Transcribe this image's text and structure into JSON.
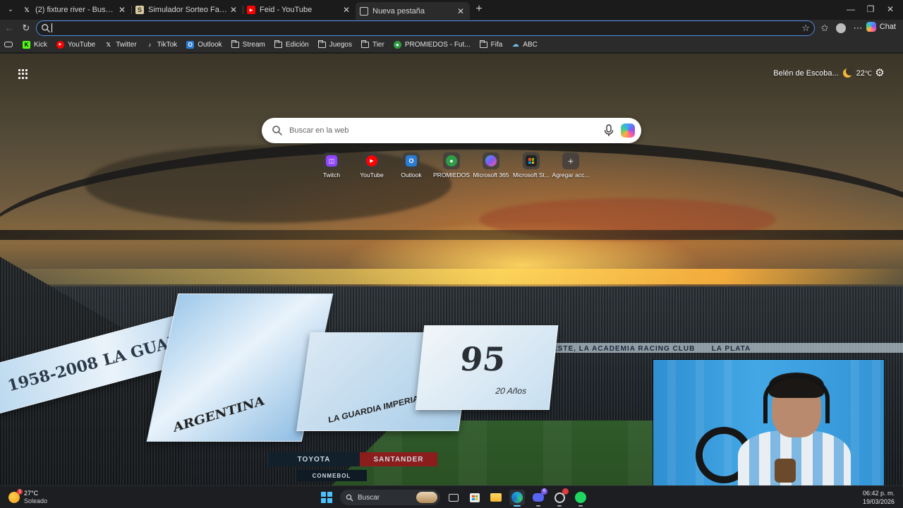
{
  "browser": {
    "tabs": [
      {
        "title": "(2) fixture river - Buscar / X",
        "favicon": "x-icon",
        "active": false
      },
      {
        "title": "Simulador Sorteo Fase de Grupos",
        "favicon": "simulador-icon",
        "active": false
      },
      {
        "title": "Feid - YouTube",
        "favicon": "youtube-icon",
        "active": false
      },
      {
        "title": "Nueva pestaña",
        "favicon": "newtab-icon",
        "active": true
      }
    ],
    "address_value": "",
    "chat_label": "Chat",
    "accent": "#4f8ee8"
  },
  "bookmarks": [
    {
      "label": "Kick",
      "icon": "kick-icon",
      "color": "#53fc18"
    },
    {
      "label": "YouTube",
      "icon": "youtube-icon",
      "color": "#ff0000"
    },
    {
      "label": "Twitter",
      "icon": "x-icon",
      "color": "#000000"
    },
    {
      "label": "TikTok",
      "icon": "tiktok-icon",
      "color": "#111111"
    },
    {
      "label": "Outlook",
      "icon": "outlook-icon",
      "color": "#2b7cd3"
    },
    {
      "label": "Stream",
      "icon": "folder-icon"
    },
    {
      "label": "Edición",
      "icon": "folder-icon"
    },
    {
      "label": "Juegos",
      "icon": "folder-icon"
    },
    {
      "label": "Tier",
      "icon": "folder-icon"
    },
    {
      "label": "PROMIEDOS - Fut...",
      "icon": "promiedos-icon",
      "color": "#2e9e44"
    },
    {
      "label": "Fifa",
      "icon": "folder-icon"
    },
    {
      "label": "ABC",
      "icon": "abc-icon",
      "color": "#3aa0c8"
    }
  ],
  "ntp": {
    "location": "Belén de Escoba...",
    "temperature": "22",
    "temperature_unit": "℃",
    "search_placeholder": "Buscar en la web",
    "quick_links": [
      {
        "label": "Twitch",
        "icon": "twitch-icon",
        "color": "#9146ff"
      },
      {
        "label": "YouTube",
        "icon": "youtube-icon",
        "color": "#ff0000"
      },
      {
        "label": "Outlook",
        "icon": "outlook-icon",
        "color": "#2b7cd3"
      },
      {
        "label": "PROMIEDOS",
        "icon": "promiedos-icon",
        "color": "#2e9e44"
      },
      {
        "label": "Microsoft 365",
        "icon": "m365-icon",
        "color": "#7f5af0"
      },
      {
        "label": "Microsoft St...",
        "icon": "store-icon",
        "color": "#333333"
      },
      {
        "label": "Agregar acc...",
        "icon": "plus-icon",
        "color": "#555555"
      }
    ],
    "stadium_banners": [
      "LA GUARDIA",
      "1958-2008",
      "ARGENTINA",
      "LA GUARDIA IMPERIAL",
      "95",
      "20 Años",
      "CELESTE, LA ACADEMIA RACING CLUB",
      "LA PLATA",
      "TOYOTA",
      "SANTANDER",
      "CONMEBOL"
    ]
  },
  "taskbar": {
    "weather_temp": "27°C",
    "weather_desc": "Soleado",
    "weather_badge": "1",
    "search_label": "Buscar",
    "discord_badge": "6",
    "time": "06:42 p. m.",
    "date": "19/03/2026"
  }
}
